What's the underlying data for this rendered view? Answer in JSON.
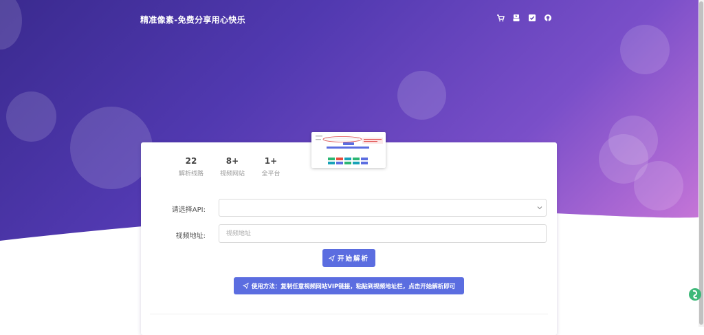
{
  "navbar": {
    "brand": "精准像素-免费分享用心快乐",
    "icons": [
      "cart-icon",
      "youtube-icon",
      "badge-icon",
      "github-icon"
    ]
  },
  "stats": [
    {
      "value": "22",
      "label": "解析线路"
    },
    {
      "value": "8+",
      "label": "视频网站"
    },
    {
      "value": "1+",
      "label": "全平台"
    }
  ],
  "form": {
    "api_label": "请选择API:",
    "api_selected": "",
    "url_label": "视频地址:",
    "url_placeholder": "视频地址",
    "url_value": ""
  },
  "buttons": {
    "start": "开始解析",
    "usage": "使用方法：复制任意视频网站VIP链接，粘贴到视频地址栏，点击开始解析即可"
  },
  "colors": {
    "accent": "#5b6de0",
    "hero_start": "#3a2a8f",
    "hero_end": "#cf7ad8"
  }
}
